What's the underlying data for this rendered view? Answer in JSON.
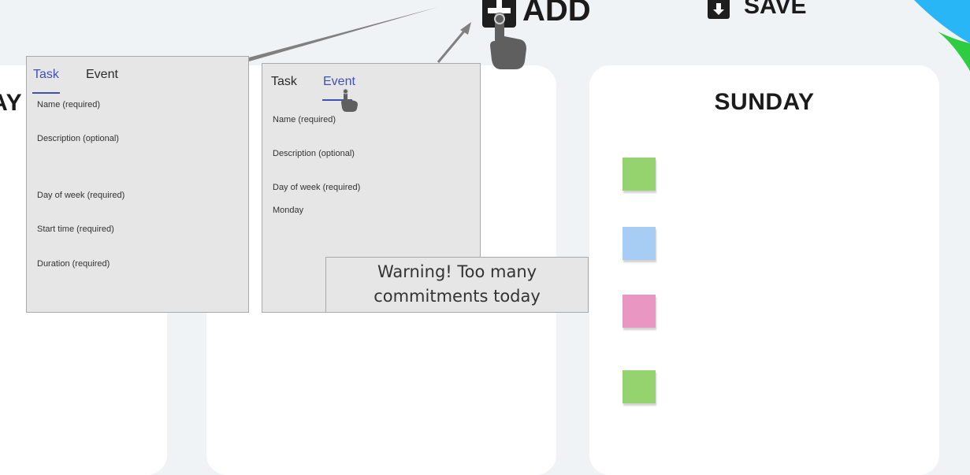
{
  "toolbar": {
    "add_label": "ADD",
    "save_label": "SAVE",
    "add_icon": "plus-square-icon",
    "save_icon": "download-icon"
  },
  "days": {
    "left_partial_title": "DAY",
    "sunday_title": "SUNDAY"
  },
  "sunday_notes": [
    {
      "color": "#94d36e"
    },
    {
      "color": "#a8cdf4"
    },
    {
      "color": "#ea96c2"
    },
    {
      "color": "#94d36e"
    }
  ],
  "task_dialog": {
    "tab_task": "Task",
    "tab_event": "Event",
    "active_tab": "Task",
    "fields": {
      "name": "Name (required)",
      "description": "Description (optional)",
      "day_of_week": "Day of week (required)",
      "start_time": "Start time (required)",
      "duration": "Duration (required)"
    }
  },
  "event_dialog": {
    "tab_task": "Task",
    "tab_event": "Event",
    "active_tab": "Event",
    "fields": {
      "name": "Name (required)",
      "description": "Description (optional)",
      "day_of_week": "Day of week (required)",
      "day_value": "Monday"
    }
  },
  "warning": {
    "line1": "Warning! Too many",
    "line2": "commitments today"
  },
  "colors": {
    "background": "#f0f3f6",
    "accent": "#3f51b5",
    "dialog_bg": "#e6e6e6",
    "callout_gray": "#808080",
    "corner_blue": "#29b6f6",
    "corner_green": "#2ecc40"
  }
}
